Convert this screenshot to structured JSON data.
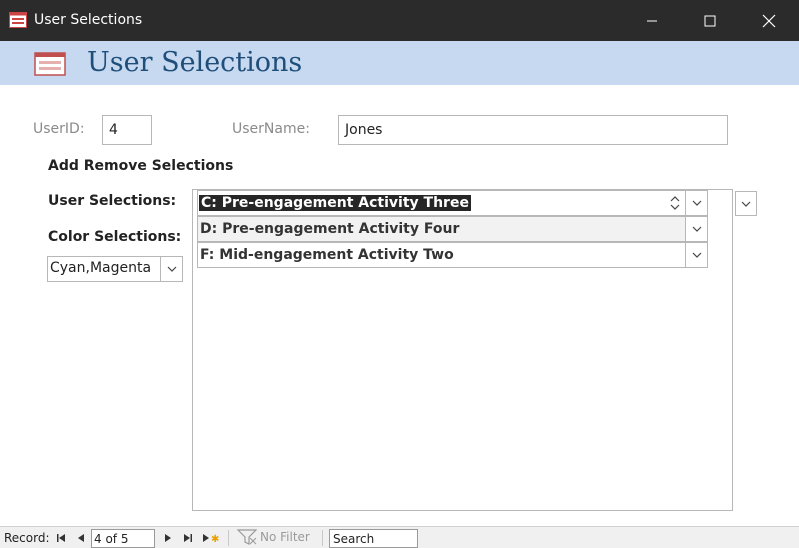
{
  "window": {
    "title": "User Selections"
  },
  "form": {
    "title": "User Selections"
  },
  "fields": {
    "userid_label": "UserID:",
    "userid_value": "4",
    "username_label": "UserName:",
    "username_value": "Jones"
  },
  "section_heading": "Add Remove Selections",
  "user_selections_label": "User Selections:",
  "color_selections_label": "Color Selections:",
  "color_selections_value": "Cyan,Magenta",
  "user_selection_rows": [
    {
      "text": "C: Pre-engagement Activity Three"
    },
    {
      "text": "D: Pre-engagement Activity Four"
    },
    {
      "text": "F: Mid-engagement Activity Two"
    }
  ],
  "navigator": {
    "record_label": "Record:",
    "record_position": "4 of 5",
    "filter_label": "No Filter",
    "search_placeholder": "Search"
  },
  "colors": {
    "titlebar": "#2b2b2b",
    "header_band": "#c6d9f1",
    "header_title": "#1f4e79"
  }
}
